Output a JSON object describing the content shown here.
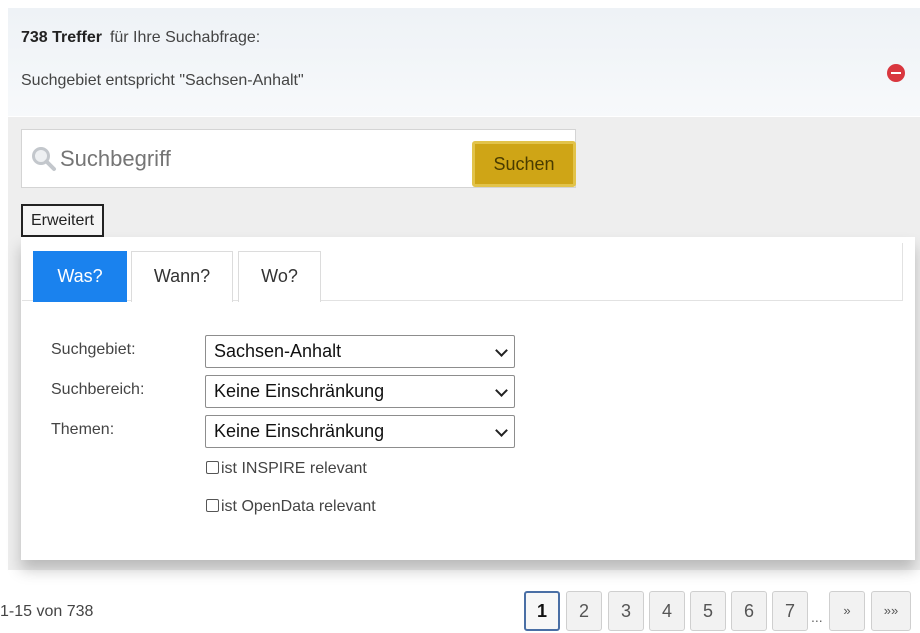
{
  "result_header": {
    "hits_count": "738 Treffer",
    "hits_suffix": "für Ihre Suchabfrage:",
    "area_filter": "Suchgebiet entspricht \"Sachsen-Anhalt\"",
    "remove_filter_icon": "remove-circle-icon"
  },
  "search": {
    "placeholder": "Suchbegriff",
    "value": "",
    "button_label": "Suchen",
    "advanced_label": "Erweitert"
  },
  "tabs": [
    {
      "label": "Was?",
      "active": true
    },
    {
      "label": "Wann?",
      "active": false
    },
    {
      "label": "Wo?",
      "active": false
    }
  ],
  "form": {
    "area_label": "Suchgebiet:",
    "area_value": "Sachsen-Anhalt",
    "scope_label": "Suchbereich:",
    "scope_value": "Keine Einschränkung",
    "topics_label": "Themen:",
    "topics_value": "Keine Einschränkung",
    "inspire_label": "ist INSPIRE relevant",
    "inspire_checked": false,
    "opendata_label": "ist OpenData relevant",
    "opendata_checked": false
  },
  "pagination": {
    "range": "1-15 von 738",
    "current_page": 1,
    "pages": [
      "1",
      "2",
      "3",
      "4",
      "5",
      "6",
      "7"
    ],
    "ellipsis": "...",
    "next": "»",
    "last": "»»"
  },
  "colors": {
    "accent_blue": "#1a82ee",
    "search_button": "#cfa516",
    "remove_icon": "#d9363e"
  }
}
